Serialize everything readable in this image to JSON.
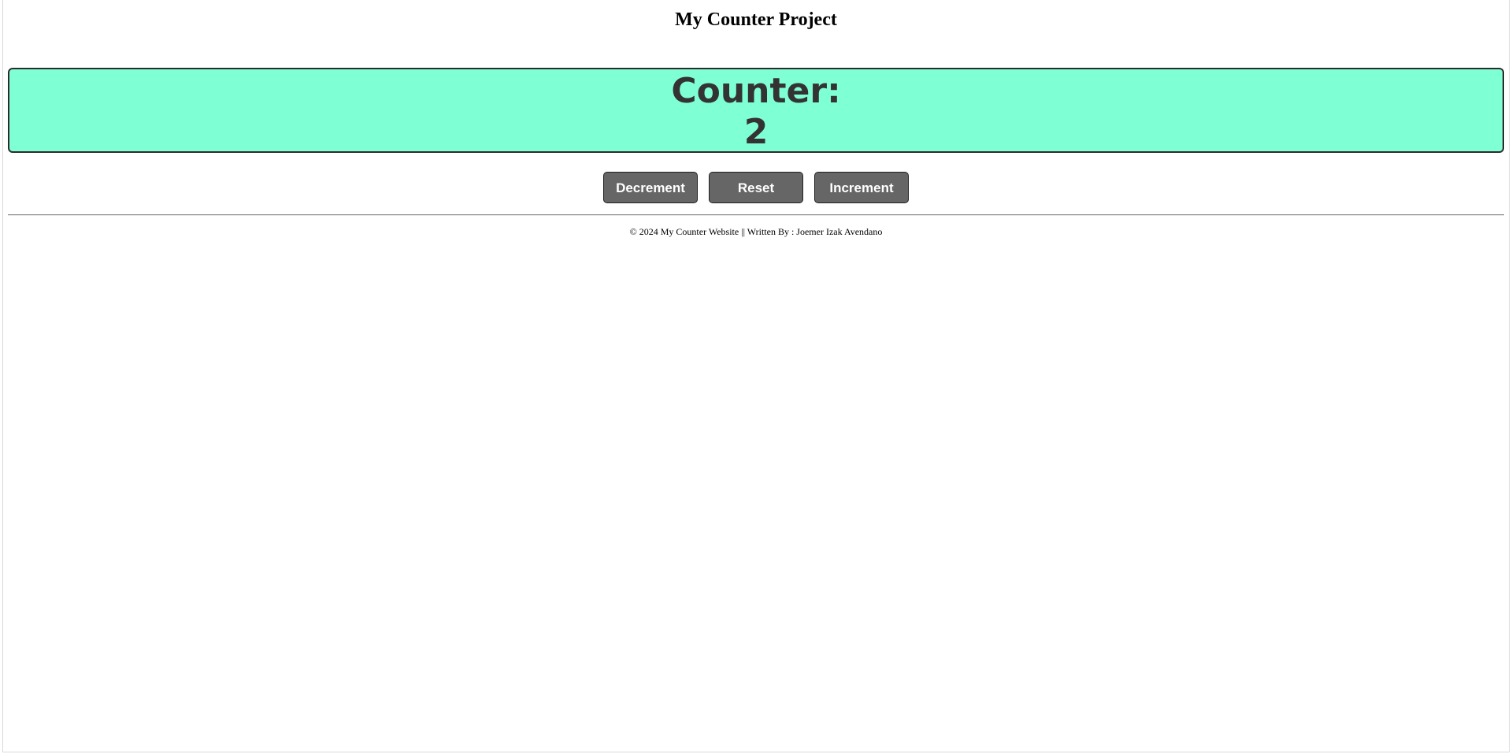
{
  "header": {
    "title": "My Counter Project"
  },
  "counter": {
    "label": "Counter:",
    "value": "2",
    "background_color": "#7fffd4"
  },
  "controls": {
    "decrement_label": "Decrement",
    "reset_label": "Reset",
    "increment_label": "Increment",
    "button_color": "#666666"
  },
  "footer": {
    "text": "© 2024 My Counter Website || Written By : Joemer Izak Avendano"
  }
}
